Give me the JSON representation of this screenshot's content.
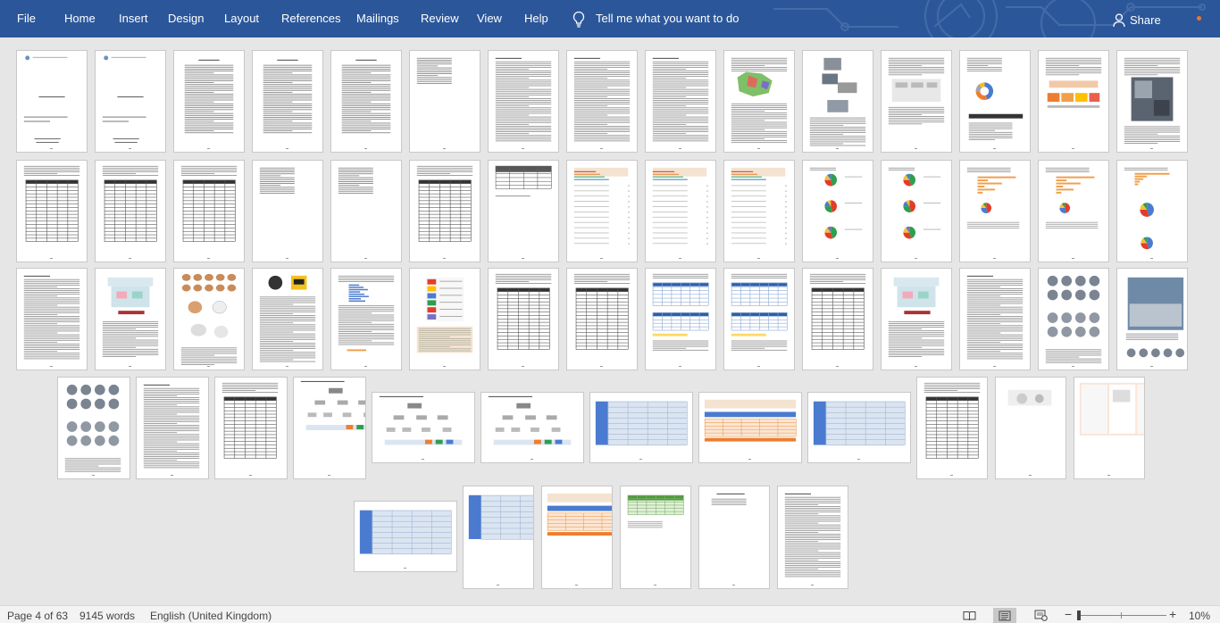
{
  "ribbon": {
    "tabs": [
      "File",
      "Home",
      "Insert",
      "Design",
      "Layout",
      "References",
      "Mailings",
      "Review",
      "View",
      "Help"
    ],
    "tell_me": "Tell me what you want to do",
    "share": "Share",
    "colors": {
      "ribbon_bg": "#2b579a",
      "text": "#ffffff",
      "notification": "#f0742a"
    }
  },
  "document": {
    "view": "multi-page",
    "page_types": [
      "cover",
      "cover",
      "toc",
      "toc",
      "toc",
      "list",
      "text",
      "text",
      "text",
      "map-text",
      "images-text",
      "diagram",
      "pie-chart",
      "cards",
      "photo-text",
      "table",
      "table",
      "table",
      "list",
      "list",
      "table",
      "strip",
      "form",
      "form",
      "form",
      "pie-charts",
      "pie-charts",
      "bar-chart",
      "bar-chart",
      "bar-pie",
      "text",
      "infographic",
      "animals",
      "logos",
      "bars-text",
      "cards-table",
      "table",
      "table",
      "blue-tables",
      "blue-tables",
      "table",
      "infographic",
      "text",
      "photos",
      "photo",
      "photos",
      "text",
      "table",
      "org-chart",
      "org-chart",
      "org-chart",
      "blue-table",
      "orange-table",
      "table",
      "table",
      "photo-small",
      "layout",
      "pie-table",
      "blue-table",
      "orange-table",
      "green-table",
      "short-text",
      "text"
    ]
  },
  "status_bar": {
    "page": "Page 4 of 63",
    "words": "9145 words",
    "language": "English (United Kingdom)",
    "zoom": "10%",
    "zoom_level": 0.1
  }
}
